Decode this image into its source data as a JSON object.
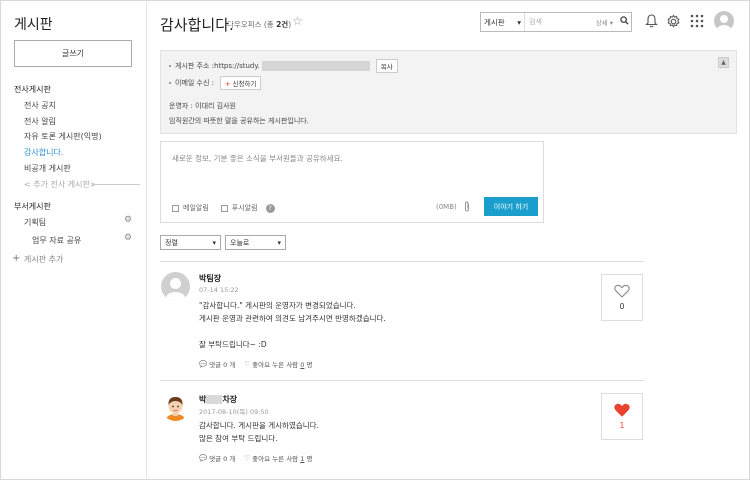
{
  "sidebar": {
    "title": "게시판",
    "write_label": "글쓰기",
    "company_section": "전사게시판",
    "company_items": [
      "전사 공지",
      "전사 알림",
      "자유 토론 게시판(익명)",
      "감사합니다.",
      "비공개 게시판"
    ],
    "company_add": "< 추가 전사 게시판>",
    "dept_section": "부서게시판",
    "dept_items": [
      "기획팀",
      "업무 자료 공유"
    ],
    "add_board": "게시판 추가"
  },
  "header": {
    "title": "감사합니다.",
    "sub_prefix": "다우오피스 (총 ",
    "sub_count": "2건",
    "sub_suffix": ")",
    "search_select": "게시판",
    "search_placeholder": "검색",
    "search_detail": "상세"
  },
  "info": {
    "address_label": "게시판 주소 :https://study.",
    "copy_label": "복사",
    "email_label": "이메일 수신 :",
    "subscribe_label": "신청하기",
    "operator": "운영자 : 이대리 김사원",
    "description": "임직원간의 따뜻한 말을 공유하는 게시판입니다."
  },
  "composer": {
    "placeholder": "새로운 정보, 기분 좋은 소식을 부서원들과 공유하세요.",
    "mail_notify": "메일알림",
    "push_notify": "푸시알림",
    "size": "(0MB)",
    "submit": "이야기 하기"
  },
  "filters": {
    "sort": "정렬",
    "order": "오늘로"
  },
  "posts": [
    {
      "author": "박팀장",
      "date": "07-14 15:22",
      "lines": [
        "\"감사합니다.\" 게시판의 운영자가 변경되었습니다.",
        "게시판 운영과 관련하여 의견도 남겨주시면 반영하겠습니다.",
        "",
        "잘 부탁드립니다~ :D"
      ],
      "comment_prefix": "댓글",
      "comment_count": "0",
      "comment_suffix": "개",
      "like_prefix": "좋아요 누른 사람",
      "like_people": "0",
      "like_suffix": "명",
      "likes": "0",
      "liked": false
    },
    {
      "author_prefix": "박",
      "author_suffix": "차장",
      "date": "2017-08-10(목) 09:50",
      "lines": [
        "감사합니다. 게시판을 게시하였습니다.",
        "많은 참여 부탁 드립니다."
      ],
      "comment_prefix": "댓글",
      "comment_count": "0",
      "comment_suffix": "개",
      "like_prefix": "좋아요 누른 사람",
      "like_people": "1",
      "like_suffix": "명",
      "likes": "1",
      "liked": true
    }
  ],
  "colors": {
    "accent": "#1a9fcd",
    "active_link": "#2a8fd0",
    "heart_red": "#e8432f"
  }
}
